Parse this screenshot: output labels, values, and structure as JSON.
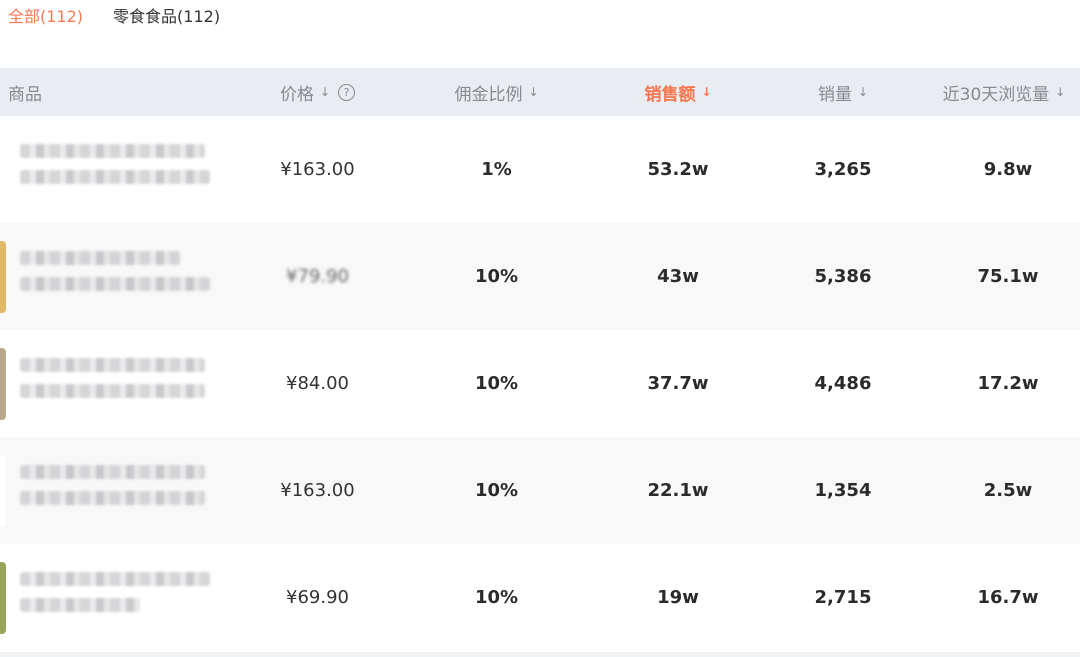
{
  "tabs": [
    {
      "label": "全部(112)",
      "active": true
    },
    {
      "label": "零食食品(112)",
      "active": false
    }
  ],
  "columns": {
    "product": "商品",
    "price": "价格",
    "commission": "佣金比例",
    "sales_amount": "销售额",
    "sales_volume": "销量",
    "views_30d": "近30天浏览量"
  },
  "sort_arrow": "↓",
  "help_icon": "?",
  "sorted_color": "#f5764f",
  "rows": [
    {
      "price": "¥163.00",
      "commission": "1%",
      "sales_amount": "53.2w",
      "sales_volume": "3,265",
      "views_30d": "9.8w",
      "thumb_color": "#ffffff"
    },
    {
      "price": "¥79.90",
      "commission": "10%",
      "sales_amount": "43w",
      "sales_volume": "5,386",
      "views_30d": "75.1w",
      "thumb_color": "#e0b866"
    },
    {
      "price": "¥84.00",
      "commission": "10%",
      "sales_amount": "37.7w",
      "sales_volume": "4,486",
      "views_30d": "17.2w",
      "thumb_color": "#b9a98a"
    },
    {
      "price": "¥163.00",
      "commission": "10%",
      "sales_amount": "22.1w",
      "sales_volume": "1,354",
      "views_30d": "2.5w",
      "thumb_color": "#ffffff"
    },
    {
      "price": "¥69.90",
      "commission": "10%",
      "sales_amount": "19w",
      "sales_volume": "2,715",
      "views_30d": "16.7w",
      "thumb_color": "#9aa35a"
    }
  ]
}
